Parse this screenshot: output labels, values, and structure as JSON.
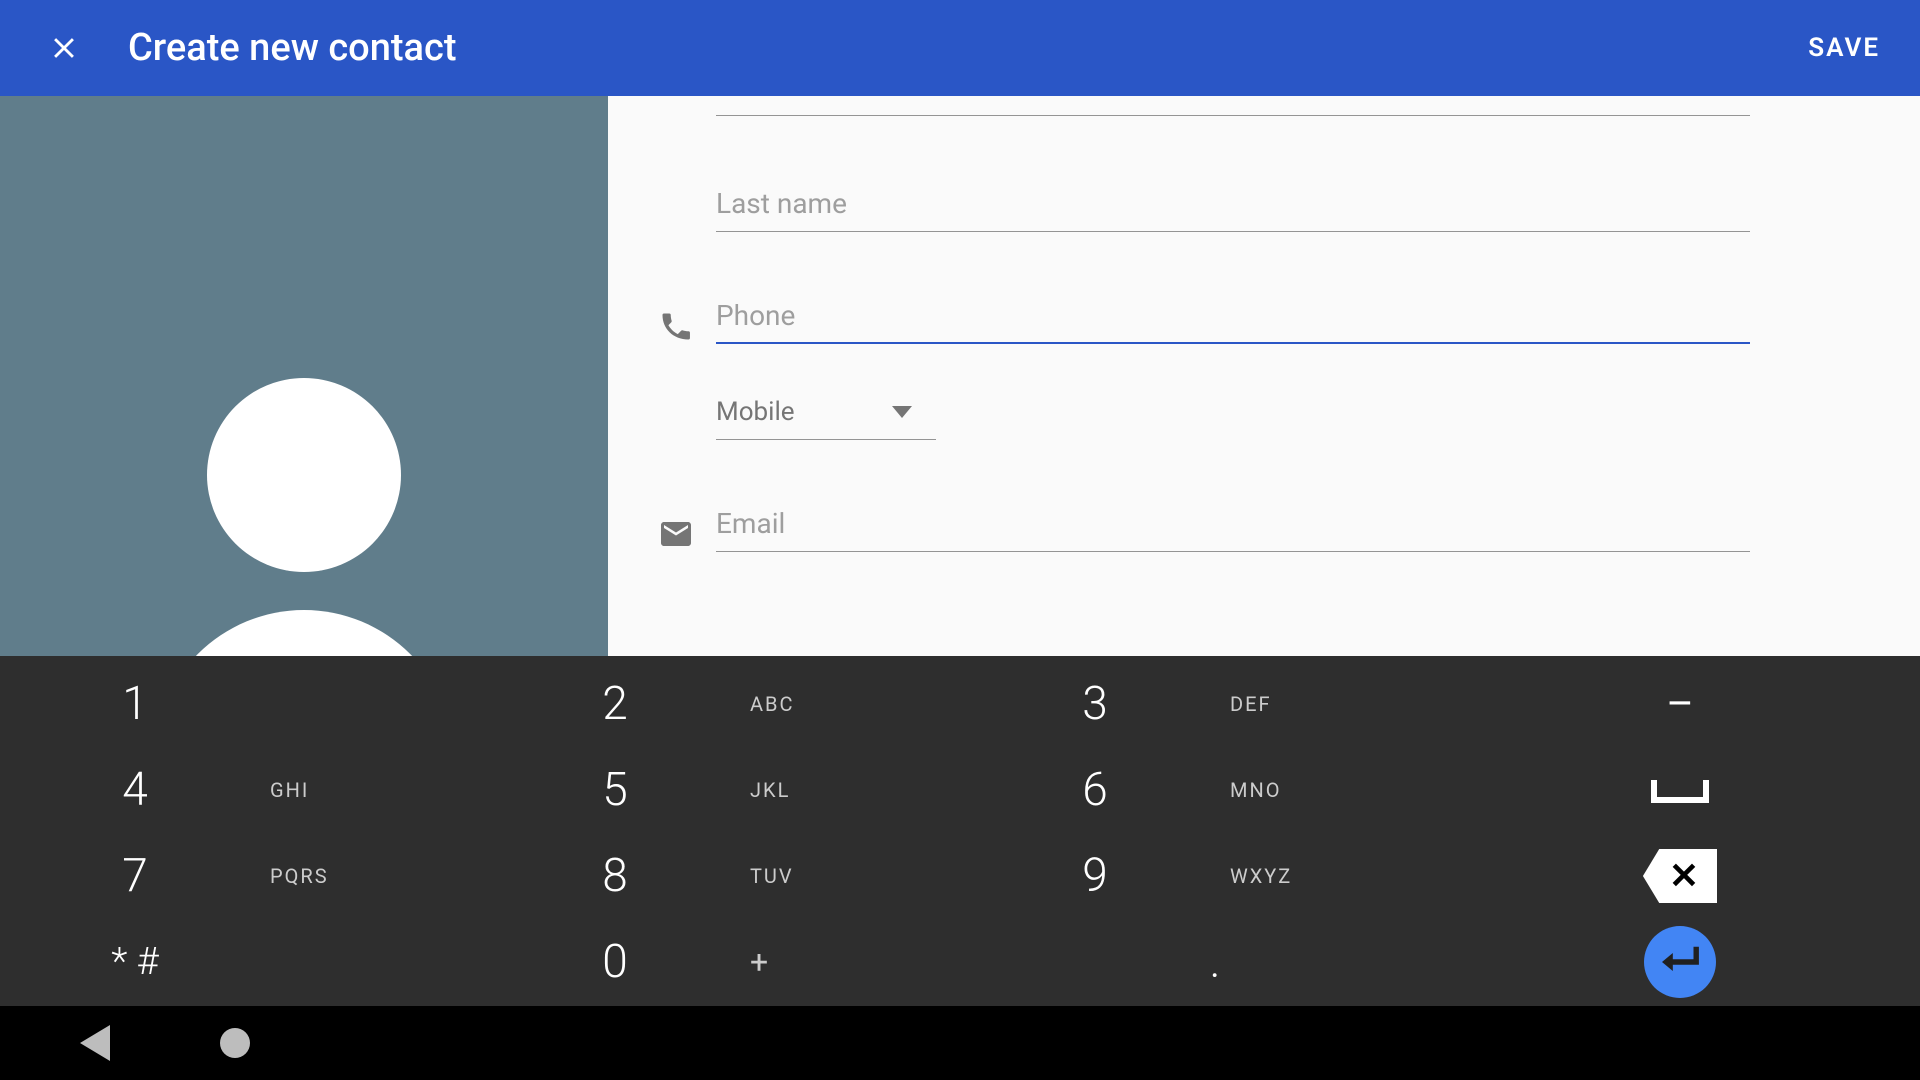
{
  "appbar": {
    "title": "Create new contact",
    "save": "SAVE"
  },
  "form": {
    "last_name_ph": "Last name",
    "phone_ph": "Phone",
    "phone_type": "Mobile",
    "email_ph": "Email"
  },
  "keypad": {
    "r1": [
      {
        "n": "1",
        "s": ""
      },
      {
        "n": "2",
        "s": "ABC"
      },
      {
        "n": "3",
        "s": "DEF"
      }
    ],
    "r2": [
      {
        "n": "4",
        "s": "GHI"
      },
      {
        "n": "5",
        "s": "JKL"
      },
      {
        "n": "6",
        "s": "MNO"
      }
    ],
    "r3": [
      {
        "n": "7",
        "s": "PQRS"
      },
      {
        "n": "8",
        "s": "TUV"
      },
      {
        "n": "9",
        "s": "WXYZ"
      }
    ],
    "r4": [
      {
        "n": "* #",
        "s": ""
      },
      {
        "n": "0",
        "s": "+"
      },
      {
        "n": ".",
        "s": ""
      }
    ],
    "util": {
      "dash": "–",
      "space": "⎵",
      "back": "✕",
      "enter": "↵"
    }
  }
}
